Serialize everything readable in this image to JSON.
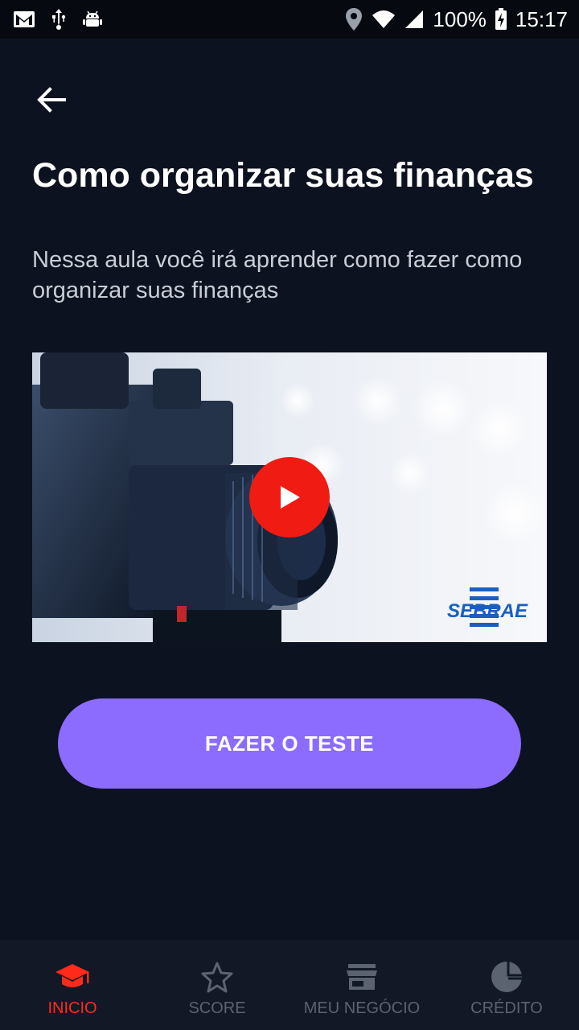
{
  "statusbar": {
    "battery": "100%",
    "time": "15:17"
  },
  "lesson": {
    "title": "Como organizar suas finanças",
    "subtitle": "Nessa aula você irá aprender como fazer como organizar suas finanças"
  },
  "video": {
    "brand": "SEBRAE"
  },
  "cta": {
    "label": "FAZER O TESTE"
  },
  "nav": {
    "items": [
      {
        "label": "INICIO",
        "icon": "graduation-cap-icon",
        "active": true
      },
      {
        "label": "SCORE",
        "icon": "star-icon",
        "active": false
      },
      {
        "label": "MEU NEGÓCIO",
        "icon": "store-icon",
        "active": false
      },
      {
        "label": "CRÉDITO",
        "icon": "pie-chart-icon",
        "active": false
      }
    ]
  },
  "colors": {
    "background": "#0d1220",
    "accent": "#8b6cff",
    "active": "#ff2a1a",
    "play": "#f01b12"
  }
}
